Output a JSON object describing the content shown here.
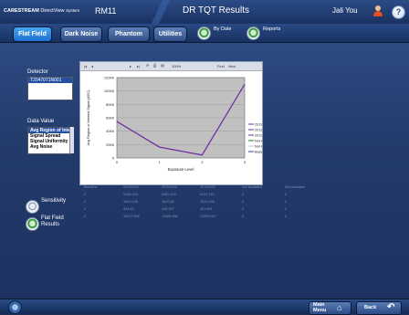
{
  "header": {
    "brand": "CARESTREAM",
    "product": "DirectView",
    "system_label": "System",
    "system_name": "RM11",
    "title": "DR TQT Results",
    "user": "Jali You"
  },
  "nav": {
    "tabs": [
      {
        "label": "Flat Field",
        "active": true
      },
      {
        "label": "Dark Noise",
        "active": false
      },
      {
        "label": "Phantom",
        "active": false
      },
      {
        "label": "Utilities",
        "active": false
      }
    ],
    "view_options": [
      {
        "label": "By Date"
      },
      {
        "label": "Reports"
      }
    ]
  },
  "detector": {
    "label": "Detector",
    "items": [
      "T2047071N001"
    ]
  },
  "data_value": {
    "label": "Data Value",
    "items": [
      "Avg Region of Interest",
      "Signal Spread",
      "Signal Uniformity (%)",
      "Avg Noise"
    ],
    "selected_index": 0
  },
  "results_options": [
    {
      "label": "Sensitivity"
    },
    {
      "label": "Flat Field Results"
    }
  ],
  "report_toolbar": {
    "zoom": "100%",
    "find_text": "Find",
    "next_text": "Next"
  },
  "chart_data": {
    "type": "line",
    "ylabel": "Avg Region of Interest Signal (ADC)",
    "xlabel": "Exposure Level",
    "x": [
      0,
      1,
      2,
      3
    ],
    "xlim": [
      0,
      3
    ],
    "ylim": [
      0,
      12000
    ],
    "yticks": [
      0,
      2000,
      4000,
      6000,
      8000,
      10000,
      12000
    ],
    "series": [
      {
        "name": "20110426",
        "color": "#7030a0",
        "values": [
          5446,
          1624,
          436,
          11008
        ]
      },
      {
        "name": "20110426",
        "color": "#7030a0",
        "values": [
          5446,
          1624,
          436,
          11008
        ]
      },
      {
        "name": "20110426",
        "color": "#7030a0",
        "values": [
          5446,
          1624,
          436,
          11008
        ]
      },
      {
        "name": "Not Available",
        "color": "#2e7d32",
        "values": []
      },
      {
        "name": "Not Available",
        "color": "#b0c4de",
        "values": []
      },
      {
        "name": "BaseLine",
        "color": "#1f4fa0",
        "values": []
      }
    ]
  },
  "results_table": {
    "headers": [
      "Baseline",
      "20110426",
      "20110426",
      "20110426",
      "Not Available",
      "Not Available"
    ],
    "rows": [
      [
        "0",
        "5446.303",
        "5452.449",
        "5437.161",
        "0",
        "0"
      ],
      [
        "0",
        "1624.106",
        "1620.82",
        "1620.446",
        "0",
        "0"
      ],
      [
        "0",
        "434.65",
        "436.327",
        "431.951",
        "0",
        "0"
      ],
      [
        "0",
        "11017.105",
        "11008.458",
        "11003.047",
        "0",
        "0"
      ]
    ]
  },
  "footer": {
    "main_menu_label": "Main Menu",
    "back_label": "Back"
  },
  "colors": {
    "header_bg": "#1f3a70",
    "active_tab": "#2f85e0",
    "chart_plot_bg": "#c0c0c0"
  }
}
